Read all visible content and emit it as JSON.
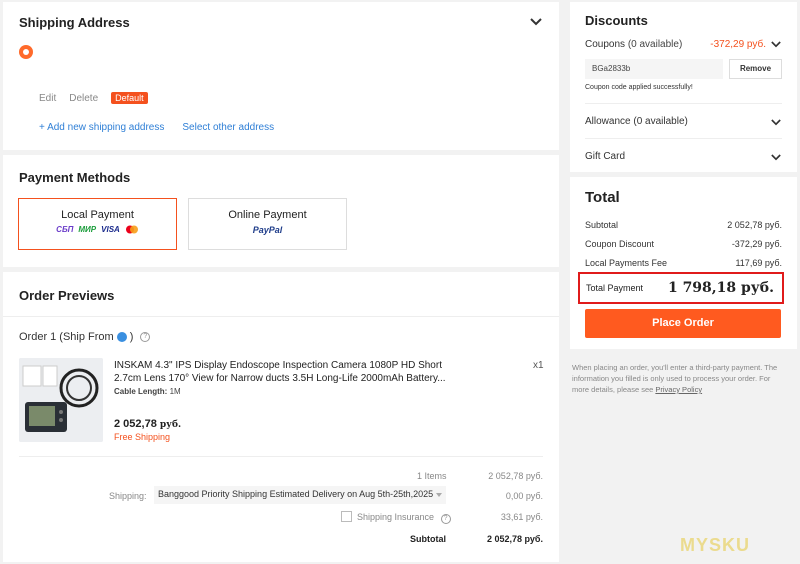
{
  "shipping": {
    "title": "Shipping Address",
    "edit_label": "Edit",
    "delete_label": "Delete",
    "default_badge": "Default",
    "add_link": "+ Add new shipping address",
    "select_link": "Select other address"
  },
  "payment": {
    "title": "Payment Methods",
    "methods": [
      {
        "label": "Local Payment",
        "logos": [
          "СБП",
          "МИР",
          "VISA",
          "mastercard"
        ],
        "selected": true
      },
      {
        "label": "Online Payment",
        "logos": [
          "PayPal"
        ],
        "selected": false
      }
    ]
  },
  "orders": {
    "title": "Order Previews",
    "order_label": "Order 1",
    "ship_from_label": "(Ship From",
    "ship_from_close": ")",
    "item": {
      "name": "INSKAM 4.3\" IPS Display Endoscope Inspection Camera 1080P HD Short 2.7cm Lens 170° View for Narrow ducts 3.5H Long-Life 2000mAh Battery...",
      "attr_label": "Cable Length:",
      "attr_value": "1M",
      "price": "2 052,78",
      "currency": "руб.",
      "shipping_note": "Free Shipping",
      "qty": "x1"
    },
    "summary": {
      "items_label": "1 Items",
      "items_value": "2 052,78 руб.",
      "shipping_label": "Shipping:",
      "shipping_method": "Banggood Priority Shipping Estimated Delivery on Aug 5th-25th,2025",
      "shipping_value": "0,00 руб.",
      "insurance_label": "Shipping Insurance",
      "insurance_value": "33,61 руб.",
      "subtotal_label": "Subtotal",
      "subtotal_value": "2 052,78 руб."
    }
  },
  "discounts": {
    "title": "Discounts",
    "coupons_label": "Coupons",
    "coupons_count": "(0 available)",
    "coupons_value": "-372,29 руб.",
    "coupon_code": "BGa2833b",
    "remove_label": "Remove",
    "applied_msg": "Coupon code applied successfully!",
    "allowance_label": "Allowance",
    "allowance_count": "(0 available)",
    "giftcard_label": "Gift Card"
  },
  "total": {
    "title": "Total",
    "rows": [
      {
        "label": "Subtotal",
        "value": "2 052,78 руб."
      },
      {
        "label": "Coupon Discount",
        "value": "-372,29 руб."
      },
      {
        "label": "Local Payments Fee",
        "value": "117,69 руб."
      }
    ],
    "total_label": "Total Payment",
    "total_value": "1 798,18 руб.",
    "place_order": "Place Order"
  },
  "note": {
    "text": "When placing an order, you'll enter a third-party payment. The information you filled is only used to process your order. For more details, please see ",
    "link": "Privacy Policy"
  },
  "watermark": "MYSKU",
  "colors": {
    "accent": "#ff5a1f",
    "link": "#2f7fd6",
    "alert": "#e01b1b"
  }
}
